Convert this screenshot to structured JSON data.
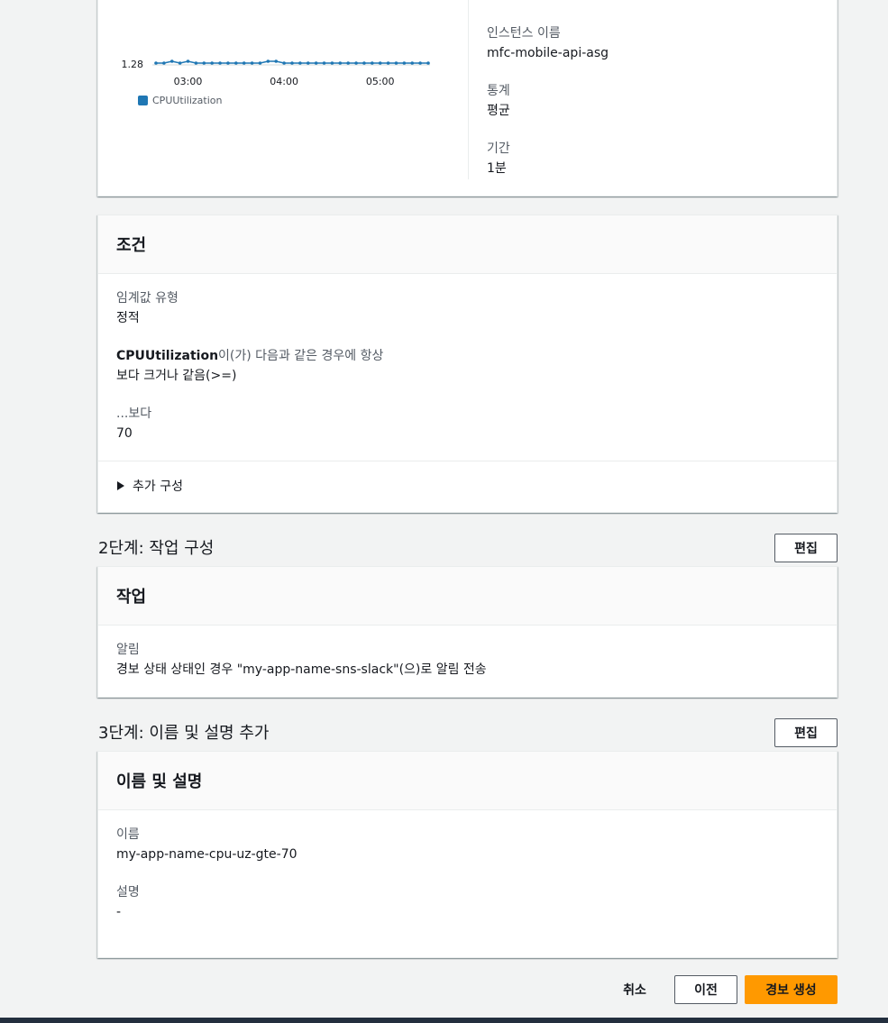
{
  "metric_panel": {
    "chart_data": {
      "type": "line",
      "x": [
        "02:40",
        "02:45",
        "02:50",
        "02:55",
        "03:00",
        "03:05",
        "03:10",
        "03:15",
        "03:20",
        "03:25",
        "03:30",
        "03:35",
        "03:40",
        "03:45",
        "03:50",
        "03:55",
        "04:00",
        "04:05",
        "04:10",
        "04:15",
        "04:20",
        "04:25",
        "04:30",
        "04:35",
        "04:40",
        "04:45",
        "04:50",
        "04:55",
        "05:00",
        "05:05",
        "05:10",
        "05:15",
        "05:20",
        "05:25",
        "05:30"
      ],
      "series": [
        {
          "name": "CPUUtilization",
          "values": [
            1.28,
            1.28,
            1.29,
            1.28,
            1.29,
            1.28,
            1.28,
            1.28,
            1.28,
            1.28,
            1.28,
            1.28,
            1.28,
            1.28,
            1.29,
            1.29,
            1.28,
            1.28,
            1.28,
            1.28,
            1.28,
            1.28,
            1.28,
            1.28,
            1.28,
            1.28,
            1.28,
            1.28,
            1.28,
            1.28,
            1.28,
            1.28,
            1.28,
            1.28,
            1.28
          ]
        }
      ],
      "y_tick": "1.28",
      "x_ticks": [
        "03:00",
        "04:00",
        "05:00"
      ],
      "legend": "CPUUtilization",
      "color": "#1f77b4"
    },
    "instance_label": "인스턴스 이름",
    "instance_value": "mfc-mobile-api-asg",
    "stat_label": "통계",
    "stat_value": "평균",
    "period_label": "기간",
    "period_value": "1분"
  },
  "conditions": {
    "title": "조건",
    "threshold_type_label": "임계값 유형",
    "threshold_type_value": "정적",
    "metric_name": "CPUUtilization",
    "condition_suffix": "이(가) 다음과 같은 경우에 항상",
    "condition_value": "보다 크거나 같음(>=)",
    "than_label": "...보다",
    "than_value": "70",
    "additional_config": "추가 구성"
  },
  "step2": {
    "title": "2단계: 작업 구성",
    "edit": "편집",
    "panel_title": "작업",
    "notification_label": "알림",
    "notification_value": "경보 상태 상태인 경우 \"my-app-name-sns-slack\"(으)로 알림 전송"
  },
  "step3": {
    "title": "3단계: 이름 및 설명 추가",
    "edit": "편집",
    "panel_title": "이름 및 설명",
    "name_label": "이름",
    "name_value": "my-app-name-cpu-uz-gte-70",
    "desc_label": "설명",
    "desc_value": "-"
  },
  "footer": {
    "cancel": "취소",
    "previous": "이전",
    "create": "경보 생성"
  },
  "colors": {
    "primary": "#ff9900",
    "line": "#1f77b4"
  }
}
